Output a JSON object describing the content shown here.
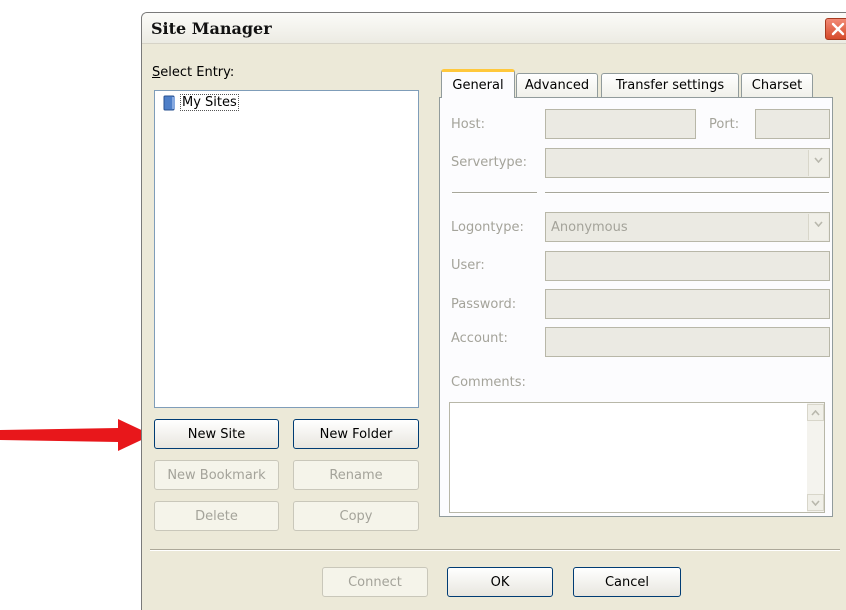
{
  "window": {
    "title": "Site Manager"
  },
  "left": {
    "select_entry_label": "Select Entry:",
    "tree": [
      {
        "label": "My Sites",
        "icon": "folder-icon"
      }
    ],
    "buttons": {
      "new_site": "New Site",
      "new_folder": "New Folder",
      "new_bookmark": "New Bookmark",
      "rename": "Rename",
      "delete": "Delete",
      "copy": "Copy"
    }
  },
  "tabs": [
    "General",
    "Advanced",
    "Transfer settings",
    "Charset"
  ],
  "general": {
    "host_label": "Host:",
    "port_label": "Port:",
    "servertype_label": "Servertype:",
    "logontype_label": "Logontype:",
    "logontype_value": "Anonymous",
    "user_label": "User:",
    "password_label": "Password:",
    "account_label": "Account:",
    "comments_label": "Comments:"
  },
  "footer": {
    "connect": "Connect",
    "ok": "OK",
    "cancel": "Cancel"
  },
  "colors": {
    "accent_tab": "#ffc83c",
    "annotation_arrow": "#e8171b",
    "close_button": "#d64a2a"
  }
}
